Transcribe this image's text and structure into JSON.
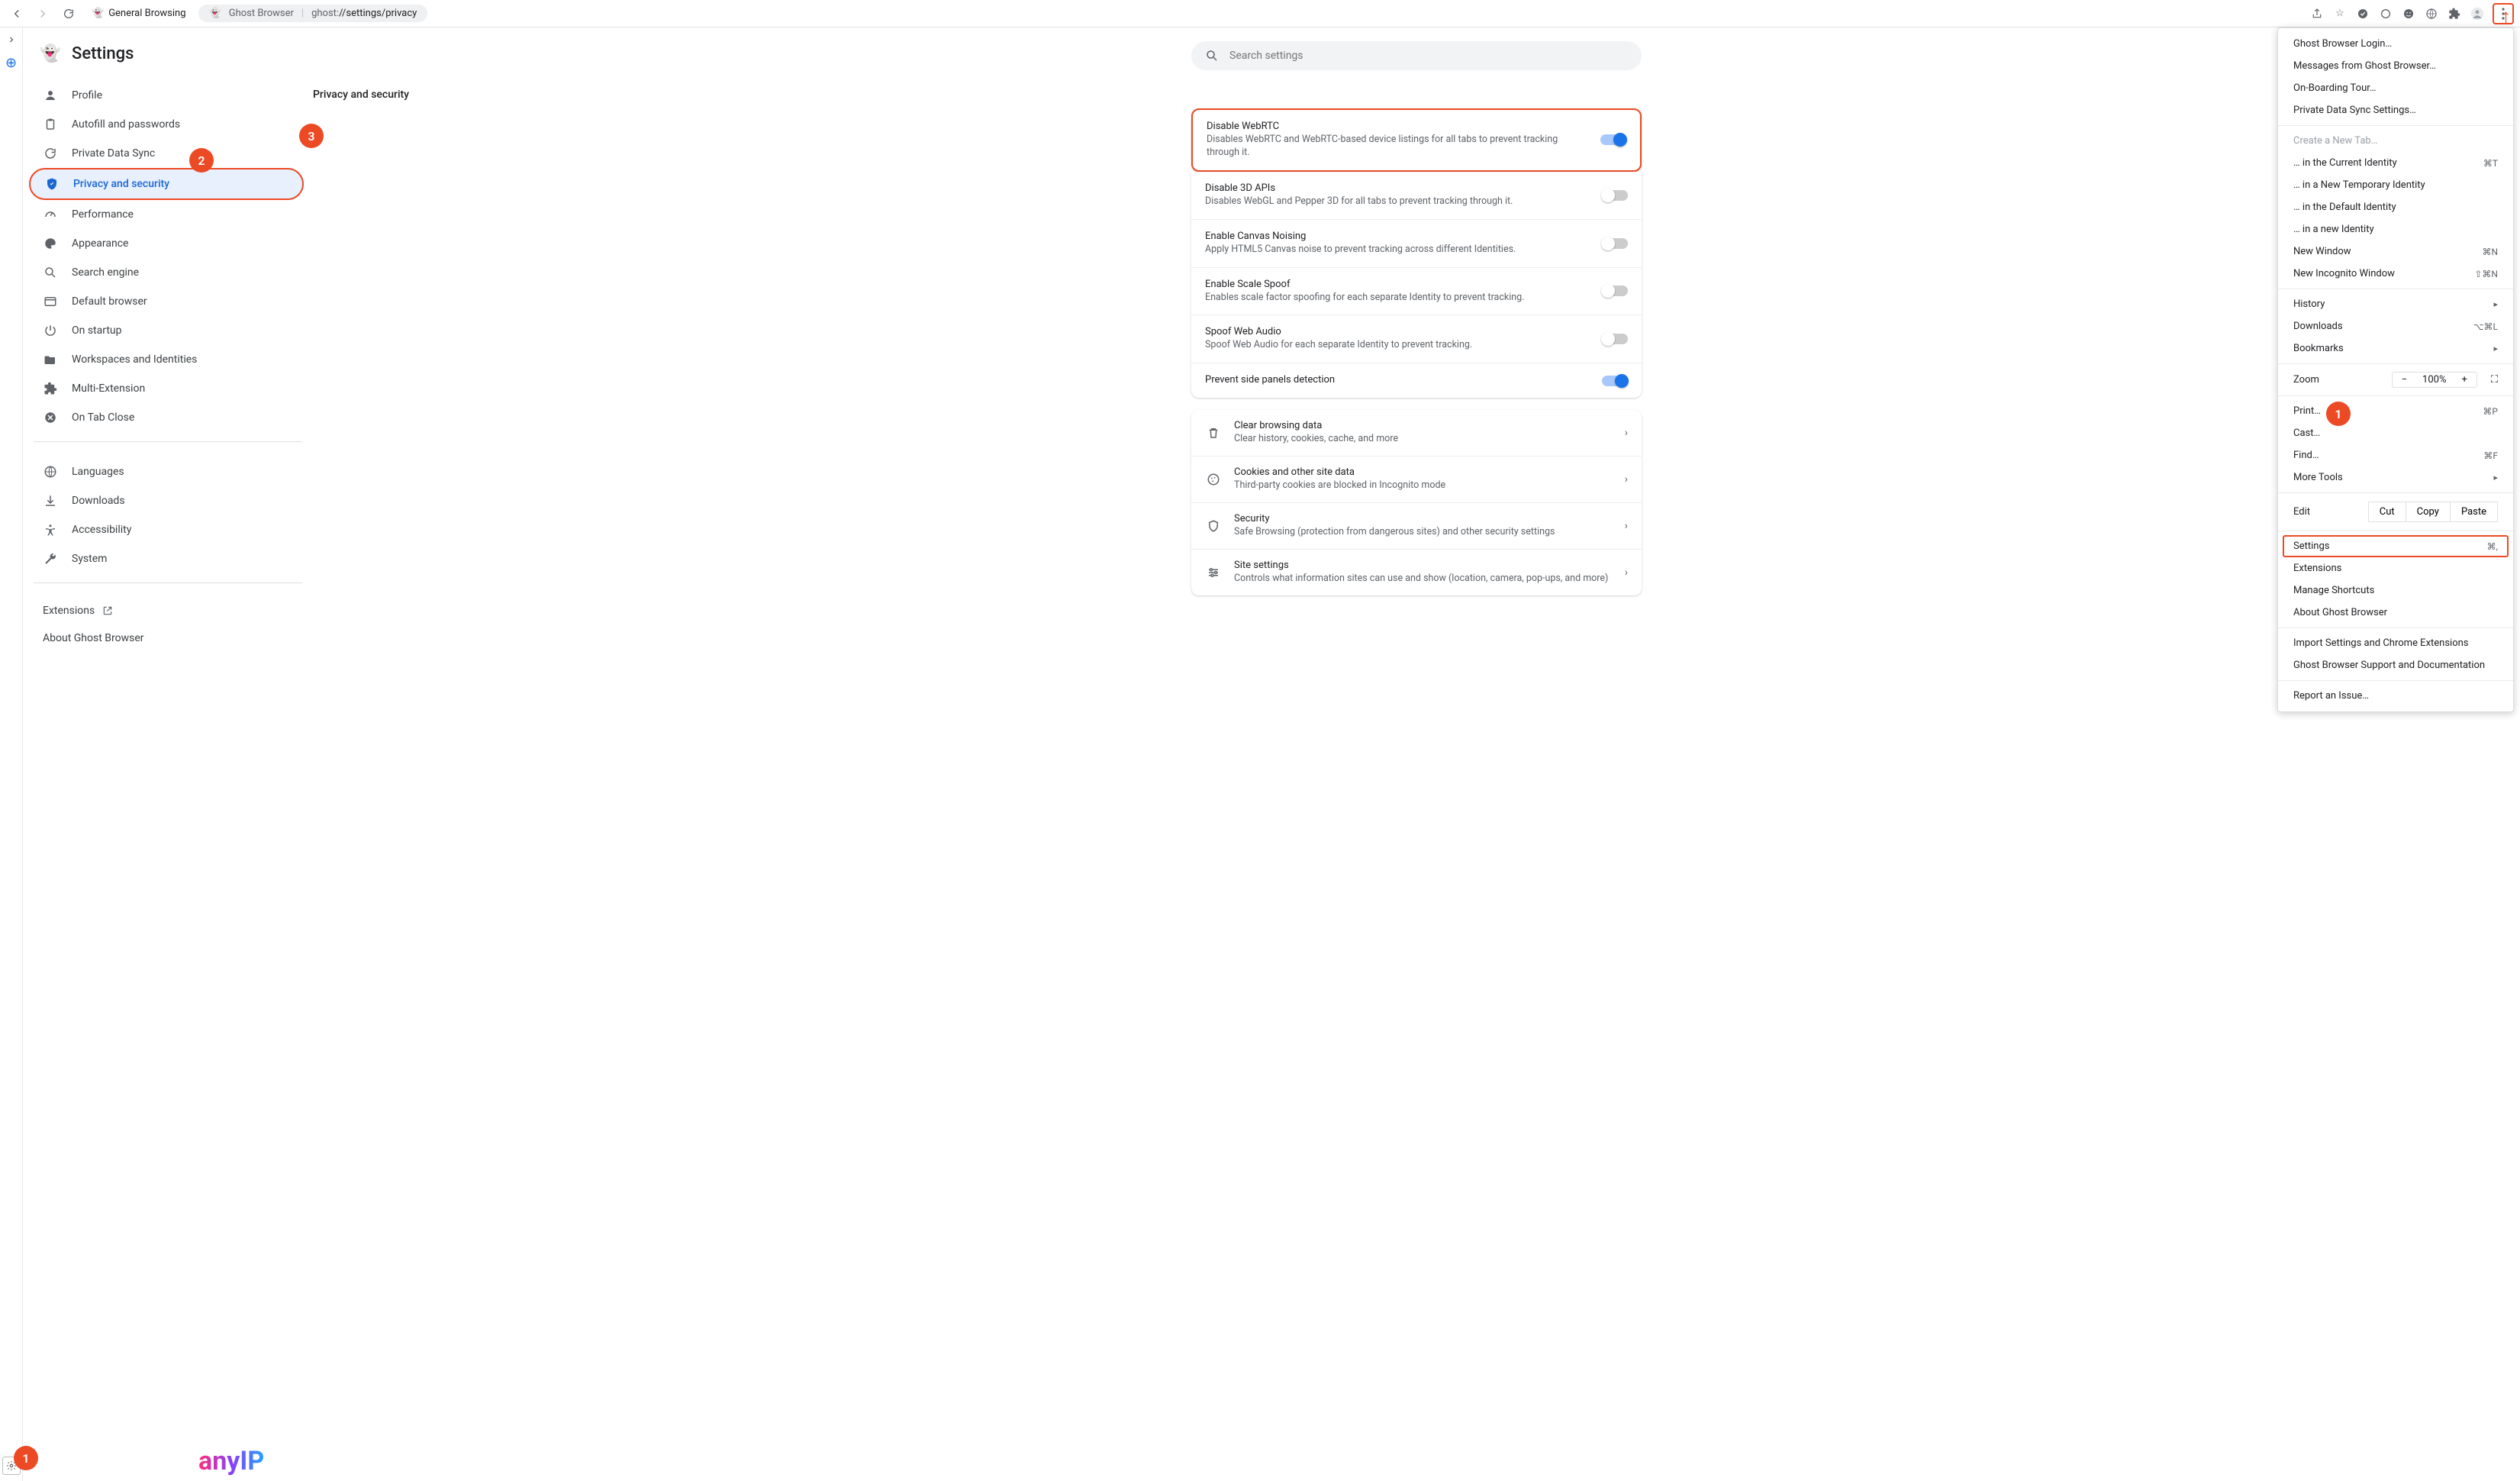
{
  "browser": {
    "profile_label": "General Browsing",
    "app_name": "Ghost Browser",
    "url_scheme": "ghost:",
    "url_path": "//settings/privacy"
  },
  "page": {
    "title": "Settings",
    "search_placeholder": "Search settings"
  },
  "sidebar": {
    "items": [
      {
        "label": "Profile"
      },
      {
        "label": "Autofill and passwords"
      },
      {
        "label": "Private Data Sync"
      },
      {
        "label": "Privacy and security"
      },
      {
        "label": "Performance"
      },
      {
        "label": "Appearance"
      },
      {
        "label": "Search engine"
      },
      {
        "label": "Default browser"
      },
      {
        "label": "On startup"
      },
      {
        "label": "Workspaces and Identities"
      },
      {
        "label": "Multi-Extension"
      },
      {
        "label": "On Tab Close"
      }
    ],
    "secondary": [
      {
        "label": "Languages"
      },
      {
        "label": "Downloads"
      },
      {
        "label": "Accessibility"
      },
      {
        "label": "System"
      }
    ],
    "footer": {
      "extensions": "Extensions",
      "about": "About Ghost Browser"
    }
  },
  "section": {
    "title": "Privacy and security",
    "toggles": [
      {
        "title": "Disable WebRTC",
        "desc": "Disables WebRTC and WebRTC-based device listings for all tabs to prevent tracking through it.",
        "on": true
      },
      {
        "title": "Disable 3D APIs",
        "desc": "Disables WebGL and Pepper 3D for all tabs to prevent tracking through it.",
        "on": false
      },
      {
        "title": "Enable Canvas Noising",
        "desc": "Apply HTML5 Canvas noise to prevent tracking across different Identities.",
        "on": false
      },
      {
        "title": "Enable Scale Spoof",
        "desc": "Enables scale factor spoofing for each separate Identity to prevent tracking.",
        "on": false
      },
      {
        "title": "Spoof Web Audio",
        "desc": "Spoof Web Audio for each separate Identity to prevent tracking.",
        "on": false
      },
      {
        "title": "Prevent side panels detection",
        "desc": "",
        "on": true
      }
    ],
    "links": [
      {
        "title": "Clear browsing data",
        "desc": "Clear history, cookies, cache, and more"
      },
      {
        "title": "Cookies and other site data",
        "desc": "Third-party cookies are blocked in Incognito mode"
      },
      {
        "title": "Security",
        "desc": "Safe Browsing (protection from dangerous sites) and other security settings"
      },
      {
        "title": "Site settings",
        "desc": "Controls what information sites can use and show (location, camera, pop-ups, and more)"
      }
    ]
  },
  "menu": {
    "top": [
      "Ghost Browser Login…",
      "Messages from Ghost Browser…",
      "On-Boarding Tour…",
      "Private Data Sync Settings…"
    ],
    "newtab_disabled": "Create a New Tab…",
    "identities": [
      {
        "label": "… in the Current Identity",
        "short": "⌘T"
      },
      {
        "label": "… in a New Temporary Identity",
        "short": ""
      },
      {
        "label": "… in the Default Identity",
        "short": ""
      },
      {
        "label": "… in a new Identity",
        "short": ""
      }
    ],
    "windows": [
      {
        "label": "New Window",
        "short": "⌘N"
      },
      {
        "label": "New Incognito Window",
        "short": "⇧⌘N"
      }
    ],
    "nav": [
      {
        "label": "History",
        "sub": true,
        "short": ""
      },
      {
        "label": "Downloads",
        "sub": false,
        "short": "⌥⌘L"
      },
      {
        "label": "Bookmarks",
        "sub": true,
        "short": ""
      }
    ],
    "zoom": {
      "label": "Zoom",
      "value": "100%"
    },
    "actions": [
      {
        "label": "Print…",
        "short": "⌘P"
      },
      {
        "label": "Cast…",
        "short": ""
      },
      {
        "label": "Find…",
        "short": "⌘F"
      },
      {
        "label": "More Tools",
        "sub": true,
        "short": ""
      }
    ],
    "edit": {
      "label": "Edit",
      "cut": "Cut",
      "copy": "Copy",
      "paste": "Paste"
    },
    "settings": {
      "label": "Settings",
      "short": "⌘,"
    },
    "more": [
      "Extensions",
      "Manage Shortcuts",
      "About Ghost Browser"
    ],
    "help": [
      "Import Settings and Chrome Extensions",
      "Ghost Browser Support and Documentation"
    ],
    "report": "Report an Issue…"
  },
  "watermark": "anyIP",
  "annotations": {
    "a1": "1",
    "a2": "2",
    "a3": "3",
    "menu1": "1"
  }
}
